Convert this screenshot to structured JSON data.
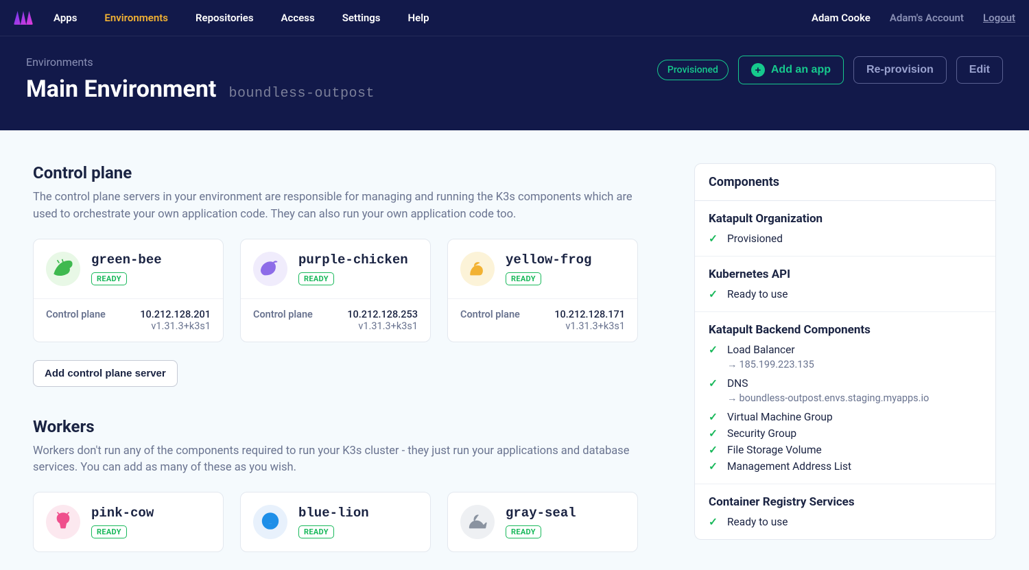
{
  "nav": {
    "items": [
      "Apps",
      "Environments",
      "Repositories",
      "Access",
      "Settings",
      "Help"
    ],
    "active_index": 1,
    "user": "Adam Cooke",
    "account": "Adam's Account",
    "logout": "Logout"
  },
  "hero": {
    "crumb": "Environments",
    "title": "Main Environment",
    "slug": "boundless-outpost",
    "status": "Provisioned",
    "add_label": "Add an app",
    "reprovision_label": "Re-provision",
    "edit_label": "Edit"
  },
  "control_plane": {
    "title": "Control plane",
    "desc": "The control plane servers in your environment are responsible for managing and running the K3s components which are used to orchestrate your own application code. They can also run your own application code too.",
    "add_button": "Add control plane server",
    "role_label": "Control plane",
    "servers": [
      {
        "name": "green-bee",
        "status": "READY",
        "ip": "10.212.128.201",
        "version": "v1.31.3+k3s1",
        "color": "green"
      },
      {
        "name": "purple-chicken",
        "status": "READY",
        "ip": "10.212.128.253",
        "version": "v1.31.3+k3s1",
        "color": "purple"
      },
      {
        "name": "yellow-frog",
        "status": "READY",
        "ip": "10.212.128.171",
        "version": "v1.31.3+k3s1",
        "color": "yellow"
      }
    ]
  },
  "workers": {
    "title": "Workers",
    "desc": "Workers don't run any of the components required to run your K3s cluster - they just run your applications and database services. You can add as many of these as you wish.",
    "servers": [
      {
        "name": "pink-cow",
        "status": "READY",
        "color": "pink"
      },
      {
        "name": "blue-lion",
        "status": "READY",
        "color": "blue"
      },
      {
        "name": "gray-seal",
        "status": "READY",
        "color": "gray"
      }
    ]
  },
  "components": {
    "header": "Components",
    "sections": [
      {
        "title": "Katapult Organization",
        "items": [
          {
            "label": "Provisioned"
          }
        ]
      },
      {
        "title": "Kubernetes API",
        "items": [
          {
            "label": "Ready to use"
          }
        ]
      },
      {
        "title": "Katapult Backend Components",
        "items": [
          {
            "label": "Load Balancer",
            "sub": "185.199.223.135"
          },
          {
            "label": "DNS",
            "sub": "boundless-outpost.envs.staging.myapps.io"
          },
          {
            "label": "Virtual Machine Group"
          },
          {
            "label": "Security Group"
          },
          {
            "label": "File Storage Volume"
          },
          {
            "label": "Management Address List"
          }
        ]
      },
      {
        "title": "Container Registry Services",
        "items": [
          {
            "label": "Ready to use"
          }
        ]
      }
    ]
  },
  "icons": {
    "green": "#3fb94f",
    "purple": "#8d6ce8",
    "yellow": "#f2b233",
    "pink": "#ef4f8c",
    "blue": "#1f8fe8",
    "gray": "#8a93a0"
  }
}
